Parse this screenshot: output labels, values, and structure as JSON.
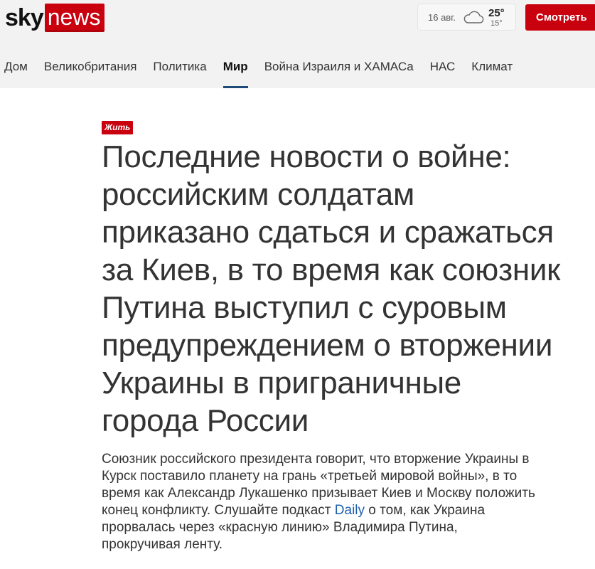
{
  "header": {
    "logo_left": "sky",
    "logo_right": "news",
    "weather": {
      "date": "16 авг.",
      "temp_high": "25°",
      "temp_low": "15°",
      "icon": "cloud-icon"
    },
    "watch_label": "Смотреть",
    "brand_color": "#c9000e"
  },
  "nav": {
    "items": [
      {
        "label": "Дом"
      },
      {
        "label": "Великобритания"
      },
      {
        "label": "Политика"
      },
      {
        "label": "Мир",
        "active": true
      },
      {
        "label": "Война Израиля и ХАМАСа"
      },
      {
        "label": "НАС"
      },
      {
        "label": "Климат"
      }
    ]
  },
  "article": {
    "badge": "Жить",
    "headline_lines": [
      "Последние новости о войне:",
      "российским солдатам",
      "приказано сдаться и сражаться",
      "за Киев, в то время как союзник",
      "Путина выступил с суровым",
      "предупреждением о вторжении",
      "Украины в приграничные",
      "города России"
    ],
    "standfirst": {
      "line1": "Союзник российского президента говорит, что вторжение Украины в",
      "line2": "Курск поставило планету на грань «третьей мировой войны», в то",
      "line3": "время как Александр Лукашенко призывает Киев и Москву положить",
      "line4_a": "конец конфликту. Слушайте подкаст ",
      "line4_link": "Daily",
      "line4_b": " о том, как Украина",
      "line5": "прорвалась через «красную линию» Владимира Путина,",
      "line6": "прокручивая ленту."
    }
  }
}
